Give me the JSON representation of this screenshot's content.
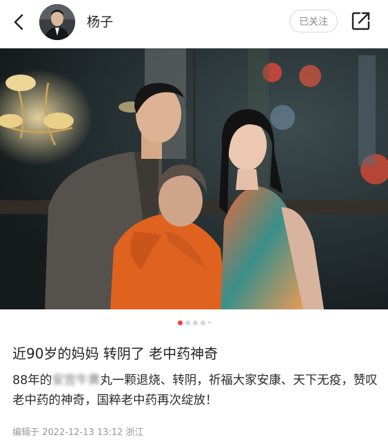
{
  "header": {
    "username": "杨子",
    "follow_label": "已关注"
  },
  "icons": {
    "back": "chevron-left-icon",
    "share": "share-icon"
  },
  "carousel": {
    "count": 5,
    "active_index": 0
  },
  "post": {
    "title": "近90岁的妈妈 转阴了 老中药神奇",
    "body_start": "88年的",
    "body_blurred": "安宫牛黄",
    "body_rest": "丸一颗退烧、转阴，祈福大家安康、天下无疫，赞叹老中药的神奇，国粹老中药再次绽放！",
    "meta": "编辑于 2022-12-13 13:12 浙江"
  },
  "colors": {
    "accent": "#f04142",
    "text": "#222222",
    "muted": "#999999"
  }
}
